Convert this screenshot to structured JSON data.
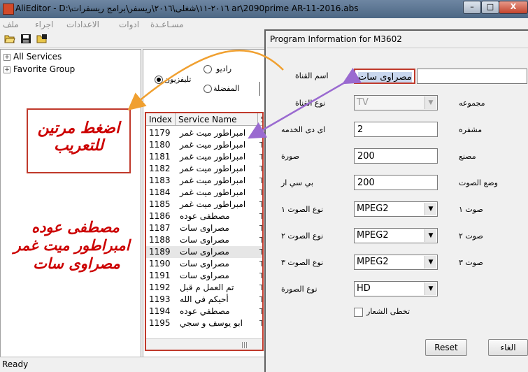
{
  "window": {
    "title": "AliEditor - D:\\٢٠١٦-١١\\شغلى\\٢٠١٦\\ريسفر\\برامج ريسفرات ar\\2090prime AR-11-2016.abs",
    "buttons": {
      "minimize": "–",
      "maximize": "□",
      "close": "X"
    }
  },
  "menu": [
    "ملف",
    "اجراء",
    "الاعدادات",
    "ادوات",
    "مسـاعـدة"
  ],
  "tree": {
    "items": [
      "All Services",
      "Favorite Group"
    ]
  },
  "annotations": {
    "box_line1": "اضغط مرتين",
    "box_line2": "للتعريب",
    "red_lines": [
      "مصطفى عوده",
      "امبراطور ميت غمر",
      "مصراوى سات"
    ]
  },
  "filter": {
    "radio": "راديو",
    "tv": "تليفزيون",
    "favorite": "المفضلة"
  },
  "list": {
    "headers": [
      "Index",
      "Service Name",
      "S"
    ],
    "rows": [
      {
        "index": "1179",
        "name": "امبراطور ميت غمر"
      },
      {
        "index": "1180",
        "name": "امبراطور ميت غمر"
      },
      {
        "index": "1181",
        "name": "امبراطور ميت غمر"
      },
      {
        "index": "1182",
        "name": "امبراطور ميت غمر"
      },
      {
        "index": "1183",
        "name": "امبراطور ميت غمر"
      },
      {
        "index": "1184",
        "name": "امبراطور ميت غمر"
      },
      {
        "index": "1185",
        "name": "امبراطور ميت غمر"
      },
      {
        "index": "1186",
        "name": "مصطفى عوده"
      },
      {
        "index": "1187",
        "name": "مصراوى سات"
      },
      {
        "index": "1188",
        "name": "مصراوى سات"
      },
      {
        "index": "1189",
        "name": "مصراوى سات"
      },
      {
        "index": "1190",
        "name": "مصراوى سات"
      },
      {
        "index": "1191",
        "name": "مصراوى سات"
      },
      {
        "index": "1192",
        "name": "تم العمل م قبل"
      },
      {
        "index": "1193",
        "name": "أحيكم في الله"
      },
      {
        "index": "1194",
        "name": "مصطفي عوده"
      },
      {
        "index": "1195",
        "name": "ابو يوسف و سجي"
      }
    ],
    "column_marker": "T"
  },
  "status": {
    "text": "Ready"
  },
  "dialog": {
    "title": "Program Information for M3602",
    "labels": {
      "channel_name": "اسم القناة",
      "channel_type": "نوع القناة",
      "group": "مجموعه",
      "service_id": "اى دى الخدمه",
      "scrambled": "مشفره",
      "video": "صورة",
      "maker": "مصنع",
      "pcr": "بي سي ار",
      "audio_mode": "وضع الصوت",
      "audio_type1": "نوع الصوت ١",
      "audio1": "صوت ١",
      "audio_type2": "نوع الصوت ٢",
      "audio2": "صوت ٢",
      "audio_type3": "نوع الصوت ٣",
      "audio3": "صوت ٣",
      "video_type": "نوع الصورة",
      "skip_logo": "تخطى الشعار"
    },
    "values": {
      "channel_name": "مصراوى سات",
      "channel_type": "TV",
      "service_id": "2",
      "video": "200",
      "pcr": "200",
      "audio1": "MPEG2",
      "audio2": "MPEG2",
      "audio3": "MPEG2",
      "video_type": "HD"
    },
    "buttons": {
      "reset": "Reset",
      "cancel": "الغاء"
    }
  }
}
